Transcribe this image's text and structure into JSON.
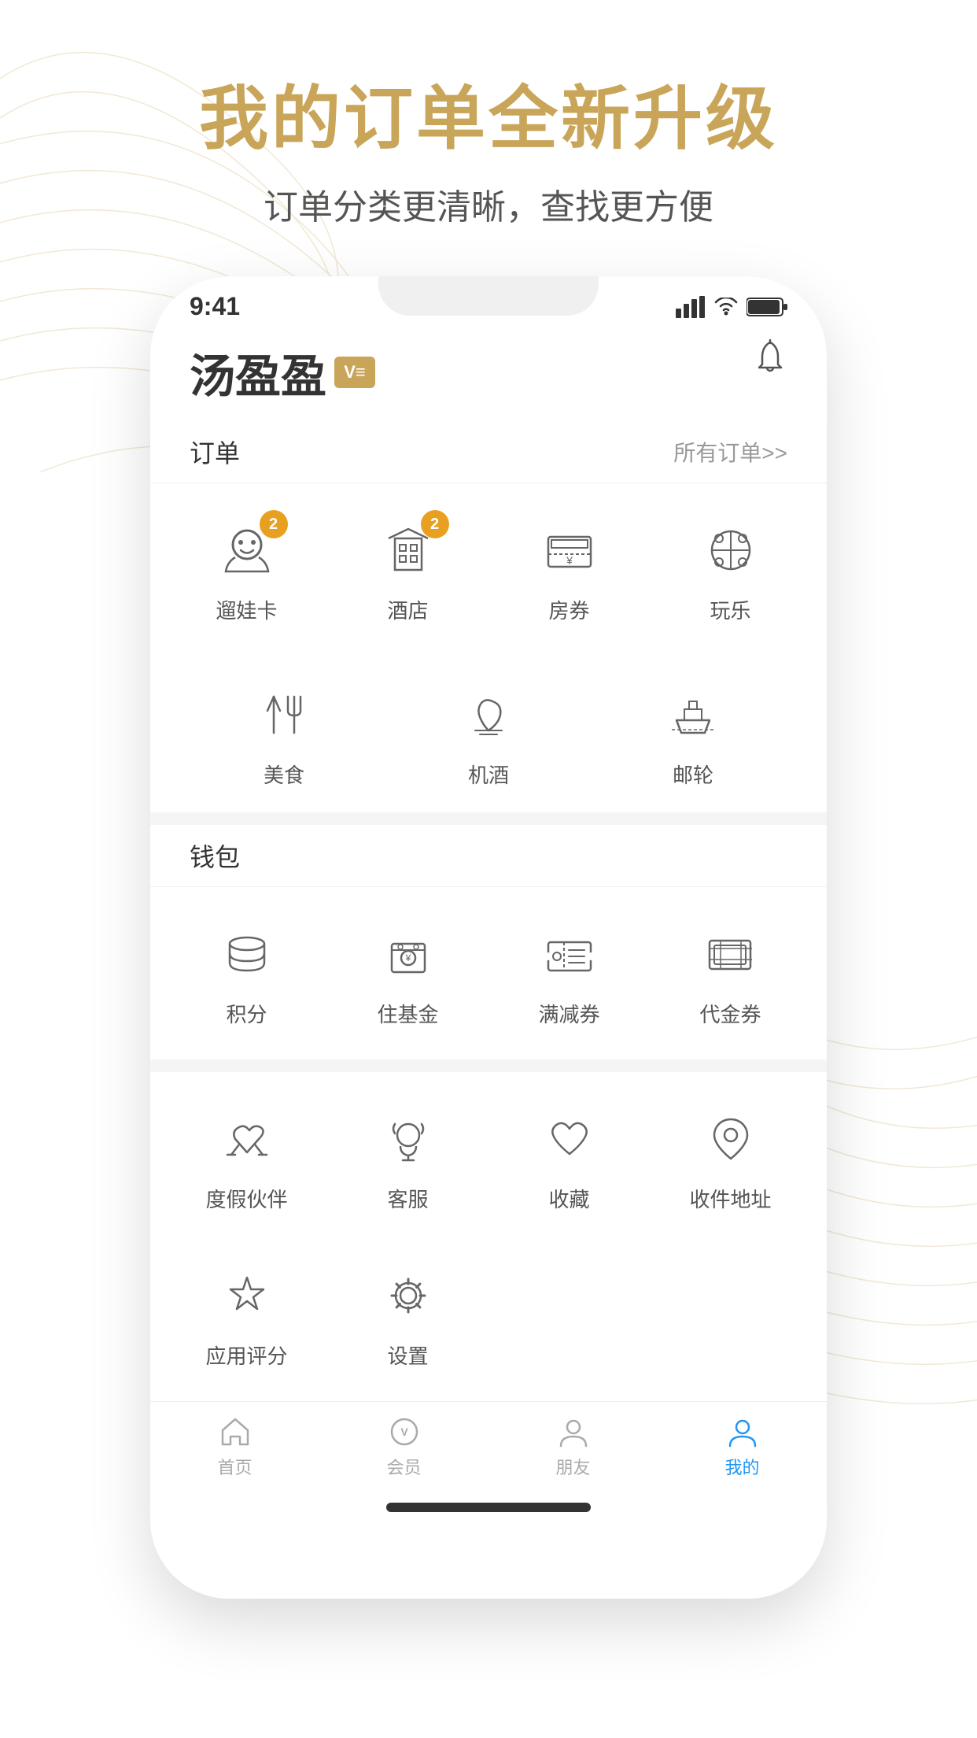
{
  "page": {
    "background": "white",
    "main_title": "我的订单全新升级",
    "sub_title": "订单分类更清晰，查找更方便"
  },
  "status_bar": {
    "time": "9:41",
    "signal": "●●●",
    "wifi": "wifi",
    "battery": "battery"
  },
  "app": {
    "logo": "汤盈盈",
    "vip_label": "V≡",
    "notification_icon": "🔔",
    "sections": {
      "orders": {
        "title": "订单",
        "more_label": "所有订单>>",
        "row1": [
          {
            "id": "baby-card",
            "label": "遛娃卡",
            "icon": "baby",
            "badge": 2
          },
          {
            "id": "hotel",
            "label": "酒店",
            "icon": "hotel",
            "badge": 2
          },
          {
            "id": "room-voucher",
            "label": "房券",
            "icon": "room",
            "badge": null
          },
          {
            "id": "entertainment",
            "label": "玩乐",
            "icon": "ferris",
            "badge": null
          }
        ],
        "row2": [
          {
            "id": "food",
            "label": "美食",
            "icon": "food",
            "badge": null
          },
          {
            "id": "air-hotel",
            "label": "机酒",
            "icon": "palm",
            "badge": null
          },
          {
            "id": "cruise",
            "label": "邮轮",
            "icon": "ship",
            "badge": null
          }
        ]
      },
      "wallet": {
        "title": "钱包",
        "items": [
          {
            "id": "points",
            "label": "积分",
            "icon": "coins"
          },
          {
            "id": "housing-fund",
            "label": "住基金",
            "icon": "housing"
          },
          {
            "id": "discount-coupon",
            "label": "满减券",
            "icon": "discount"
          },
          {
            "id": "cash-voucher",
            "label": "代金券",
            "icon": "voucher"
          }
        ]
      },
      "services": {
        "items_row1": [
          {
            "id": "vacation-partner",
            "label": "度假伙伴",
            "icon": "handshake"
          },
          {
            "id": "customer-service",
            "label": "客服",
            "icon": "headset"
          },
          {
            "id": "favorites",
            "label": "收藏",
            "icon": "heart"
          },
          {
            "id": "delivery-address",
            "label": "收件地址",
            "icon": "location"
          }
        ],
        "items_row2": [
          {
            "id": "app-rating",
            "label": "应用评分",
            "icon": "star"
          },
          {
            "id": "settings",
            "label": "设置",
            "icon": "gear"
          }
        ]
      }
    },
    "tab_bar": {
      "tabs": [
        {
          "id": "home",
          "label": "首页",
          "icon": "home",
          "active": false
        },
        {
          "id": "membership",
          "label": "会员",
          "icon": "vip",
          "active": false
        },
        {
          "id": "friends",
          "label": "朋友",
          "icon": "friends",
          "active": false
        },
        {
          "id": "mine",
          "label": "我的",
          "icon": "mine",
          "active": true
        }
      ]
    }
  }
}
